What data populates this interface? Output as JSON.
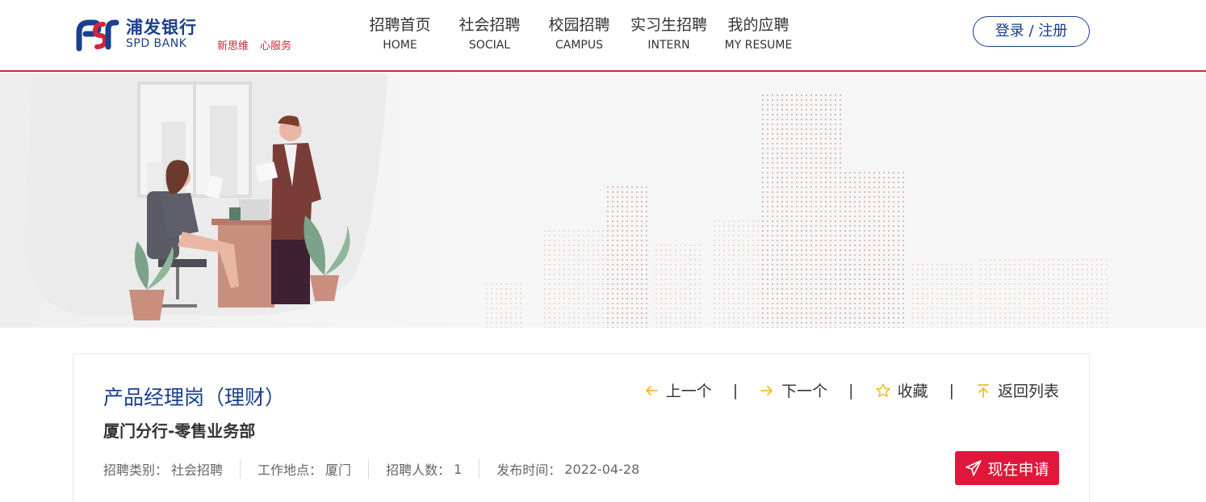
{
  "header": {
    "logo_cn": "浦发银行",
    "logo_en": "SPD BANK",
    "slogan": [
      "新思维",
      "心服务"
    ],
    "nav": [
      {
        "cn": "招聘首页",
        "en": "HOME"
      },
      {
        "cn": "社会招聘",
        "en": "SOCIAL"
      },
      {
        "cn": "校园招聘",
        "en": "CAMPUS"
      },
      {
        "cn": "实习生招聘",
        "en": "INTERN"
      },
      {
        "cn": "我的应聘",
        "en": "MY RESUME"
      }
    ],
    "login_label": "登录 / 注册"
  },
  "job": {
    "title": "产品经理岗（理财）",
    "department": "厦门分行-零售业务部",
    "meta": [
      {
        "label": "招聘类别：",
        "value": "社会招聘"
      },
      {
        "label": "工作地点：",
        "value": "厦门"
      },
      {
        "label": "招聘人数：",
        "value": "1"
      },
      {
        "label": "发布时间：",
        "value": "2022-04-28"
      }
    ]
  },
  "actions": {
    "prev_label": "上一个",
    "next_label": "下一个",
    "favorite_label": "收藏",
    "back_label": "返回列表",
    "separator": "|",
    "apply_label": "现在申请"
  },
  "colors": {
    "brand_blue": "#1b3f8c",
    "brand_red": "#d0263a",
    "apply_red": "#e0173a",
    "icon_yellow": "#f5b82e"
  }
}
